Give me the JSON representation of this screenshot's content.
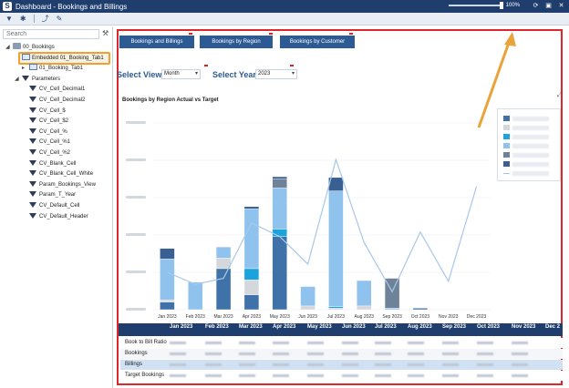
{
  "window": {
    "title": "Dashboard - Bookings and Billings",
    "zoom": "100%",
    "zoom_level": 1.0,
    "app_icon": "S"
  },
  "toolbar": {
    "icons": [
      "filter-icon",
      "gear-icon",
      "export-icon",
      "edit-icon"
    ]
  },
  "sidebar": {
    "search_placeholder": "Search",
    "tree": [
      {
        "label": "00_Bookings",
        "icon": "dashboard-icon",
        "indent": 0
      },
      {
        "label": "Embedded 01_Booking_Tab1",
        "icon": "tab-icon",
        "indent": 1,
        "selected": true
      },
      {
        "label": "01_Booking_Tab1",
        "icon": "tab-icon",
        "indent": 2
      },
      {
        "label": "Parameters",
        "icon": "funnel-icon",
        "indent": 1
      },
      {
        "label": "CV_Cell_Decimal1",
        "icon": "funnel-icon",
        "indent": 2
      },
      {
        "label": "CV_Cell_Decimal2",
        "icon": "funnel-icon",
        "indent": 2
      },
      {
        "label": "CV_Cell_$",
        "icon": "funnel-icon",
        "indent": 2
      },
      {
        "label": "CV_Cell_$2",
        "icon": "funnel-icon",
        "indent": 2
      },
      {
        "label": "CV_Cell_%",
        "icon": "funnel-icon",
        "indent": 2
      },
      {
        "label": "CV_Cell_%1",
        "icon": "funnel-icon",
        "indent": 2
      },
      {
        "label": "CV_Cell_%2",
        "icon": "funnel-icon",
        "indent": 2
      },
      {
        "label": "CV_Blank_Cell",
        "icon": "funnel-icon",
        "indent": 2
      },
      {
        "label": "CV_Blank_Cell_White",
        "icon": "funnel-icon",
        "indent": 2
      },
      {
        "label": "Param_Bookings_View",
        "icon": "funnel-icon",
        "indent": 2
      },
      {
        "label": "Param_T_Year",
        "icon": "funnel-icon",
        "indent": 2
      },
      {
        "label": "CV_Default_Cell",
        "icon": "funnel-icon",
        "indent": 2
      },
      {
        "label": "CV_Default_Header",
        "icon": "funnel-icon",
        "indent": 2
      }
    ]
  },
  "dashboard": {
    "buttons": [
      "Bookings and Billings",
      "Bookings by Region",
      "Bookings by Customer"
    ],
    "view_label": "Select View:",
    "view_value": "Month",
    "year_label": "Select Year:",
    "year_value": "2023",
    "chart_title": "Bookings by Region Actual vs Target"
  },
  "colors": {
    "accent": "#2b5a94",
    "highlight": "#f0a030",
    "frame": "#e0262a",
    "header": "#1f3e6e"
  },
  "chart_data": {
    "type": "bar",
    "stacked": true,
    "title": "Bookings by Region Actual vs Target",
    "categories": [
      "Jan 2023",
      "Feb 2023",
      "Mar 2023",
      "Apr 2023",
      "May 2023",
      "Jun 2023",
      "Jul 2023",
      "Aug 2023",
      "Sep 2023",
      "Oct 2023",
      "Nov 2023",
      "Dec 2023"
    ],
    "series": [
      {
        "color": "#3f72a8",
        "values": [
          10,
          0,
          55,
          20,
          98,
          0,
          0,
          0,
          0,
          2,
          0,
          0
        ]
      },
      {
        "color": "#d4d7dc",
        "values": [
          3,
          0,
          14,
          20,
          0,
          5,
          2,
          5,
          0,
          0,
          0,
          0
        ]
      },
      {
        "color": "#1aa3dc",
        "values": [
          0,
          0,
          0,
          15,
          10,
          0,
          2,
          0,
          0,
          0,
          0,
          0
        ]
      },
      {
        "color": "#8fc3ee",
        "values": [
          55,
          37,
          15,
          80,
          55,
          26,
          155,
          34,
          2,
          0,
          0,
          0
        ]
      },
      {
        "color": "#6f8298",
        "values": [
          0,
          0,
          0,
          0,
          12,
          0,
          0,
          0,
          40,
          0,
          0,
          0
        ]
      },
      {
        "color": "#3a5f93",
        "values": [
          14,
          0,
          0,
          3,
          3,
          0,
          18,
          0,
          0,
          0,
          0,
          0
        ]
      }
    ],
    "target_line": {
      "color": "#a7c8ea",
      "values": [
        50,
        34,
        42,
        116,
        98,
        61,
        201,
        90,
        24,
        104,
        38,
        165
      ]
    },
    "ylim": [
      0,
      250
    ],
    "legend": "right",
    "grid": true
  },
  "table": {
    "months": [
      "Jan 2023",
      "Feb 2023",
      "Mar 2023",
      "Apr 2023",
      "May 2023",
      "Jun 2023",
      "Jul 2023",
      "Aug 2023",
      "Sep 2023",
      "Oct 2023",
      "Nov 2023",
      "Dec 2"
    ],
    "rows": [
      "Book to Bill Ratio",
      "Bookings",
      "Billings",
      "Target Bookings"
    ]
  }
}
